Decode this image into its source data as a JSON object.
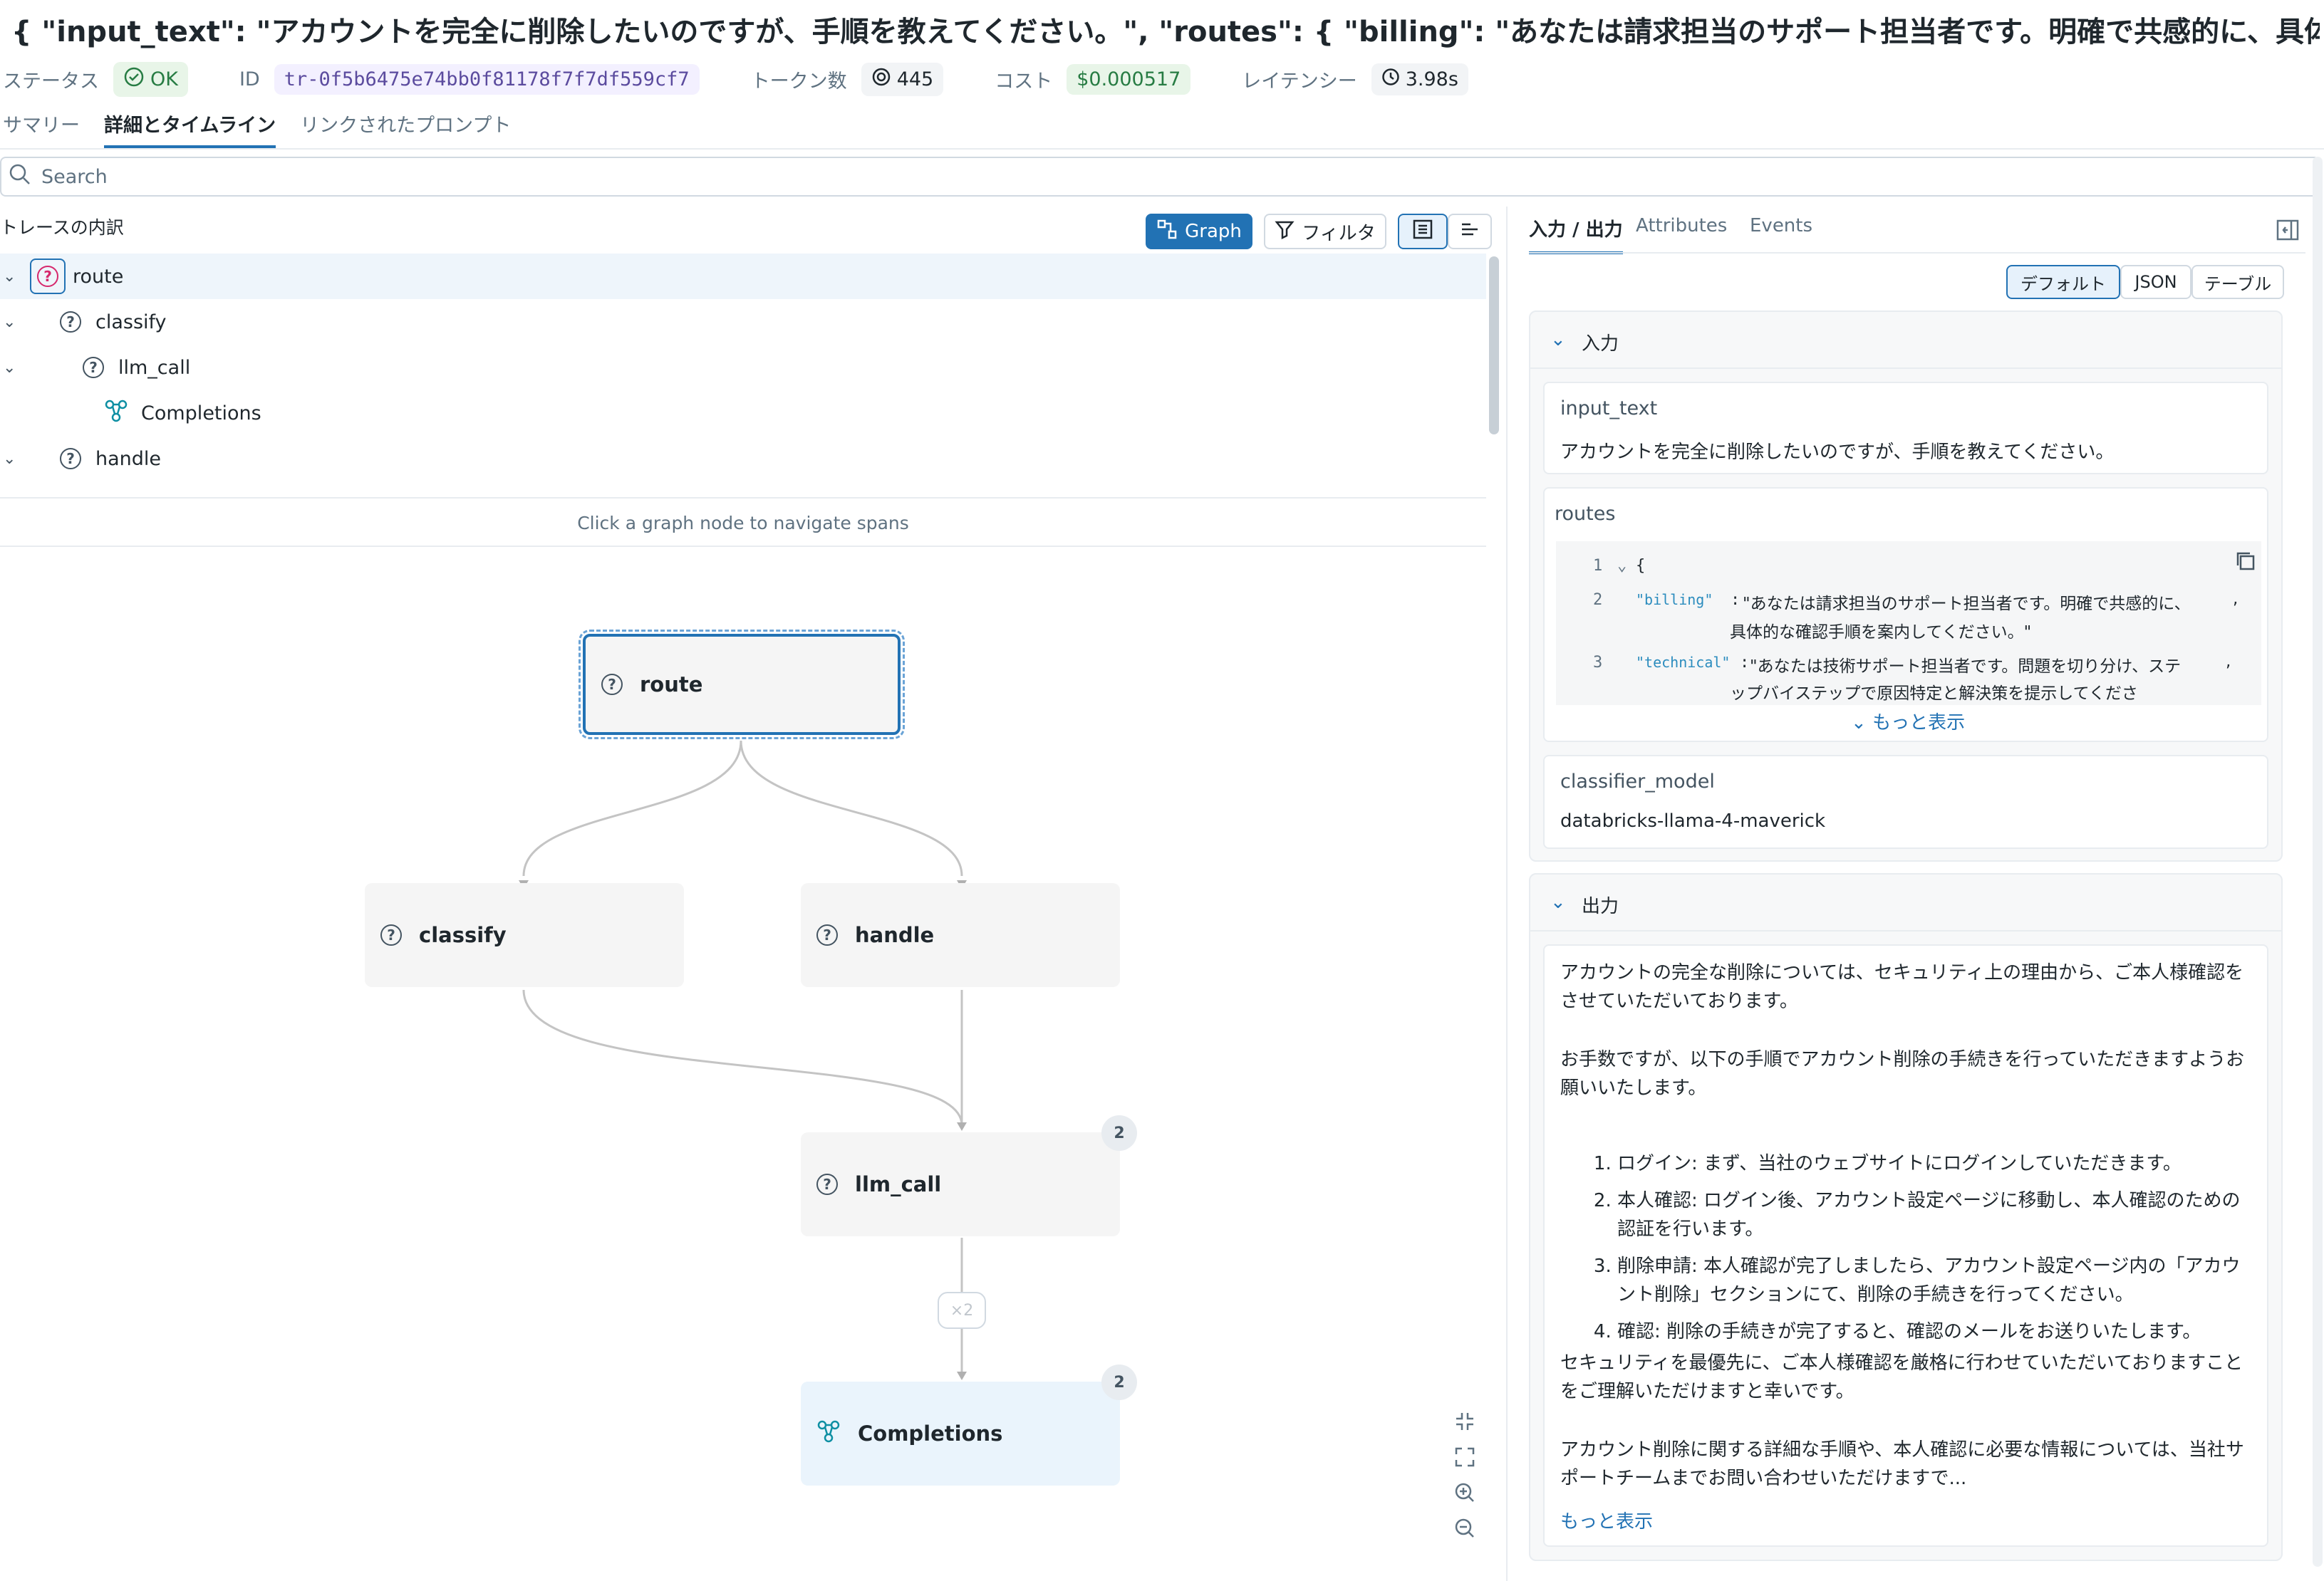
{
  "header": {
    "title": "{ \"input_text\": \"アカウントを完全に削除したいのですが、手順を教えてください。\", \"routes\": { \"billing\": \"あなたは請求担当のサポート担当者です。明確で共感的に、具体的な",
    "status_label": "ステータス",
    "status_value": "OK",
    "id_label": "ID",
    "id_value": "tr-0f5b6475e74bb0f81178f7f7df559cf7",
    "tokens_label": "トークン数",
    "tokens_value": "445",
    "cost_label": "コスト",
    "cost_value": "$0.000517",
    "latency_label": "レイテンシー",
    "latency_value": "3.98s"
  },
  "tabs": [
    "サマリー",
    "詳細とタイムライン",
    "リンクされたプロンプト"
  ],
  "search": {
    "placeholder": "Search"
  },
  "trace": {
    "title": "トレースの内訳",
    "graph_button": "Graph",
    "filter_button": "フィルタ",
    "rows": [
      {
        "label": "route"
      },
      {
        "label": "classify"
      },
      {
        "label": "llm_call"
      },
      {
        "label": "Completions"
      },
      {
        "label": "handle"
      }
    ],
    "hint": "Click a graph node to navigate spans"
  },
  "graph": {
    "nodes": {
      "route": "route",
      "classify": "classify",
      "handle": "handle",
      "llm_call": "llm_call",
      "llm_call_count": "2",
      "completions": "Completions",
      "completions_count": "2",
      "edge_label": "×2"
    }
  },
  "right": {
    "tabs": [
      "入力 / 出力",
      "Attributes",
      "Events"
    ],
    "view_modes": [
      "デフォルト",
      "JSON",
      "テーブル"
    ],
    "input_section": "入力",
    "input_text_key": "input_text",
    "input_text_value": "アカウントを完全に削除したいのですが、手順を教えてください。",
    "routes_key": "routes",
    "routes_code": {
      "l1": "{",
      "l2_key": "\"billing\"",
      "l2_val": "\"あなたは請求担当のサポート担当者です。明確で共感的に、",
      "l2_cont": "具体的な確認手順を案内してください。\"",
      "l3_key": "\"technical\"",
      "l3_val": "\"あなたは技術サポート担当者です。問題を切り分け、ステ",
      "l3_cont": "ップバイステップで原因特定と解決策を提示してくださ"
    },
    "show_more": "もっと表示",
    "classifier_key": "classifier_model",
    "classifier_value": "databricks-llama-4-maverick",
    "output_section": "出力",
    "output": {
      "p1": "アカウントの完全な削除については、セキュリティ上の理由から、ご本人様確認をさせていただいております。",
      "p2": "お手数ですが、以下の手順でアカウント削除の手続きを行っていただきますようお願いいたします。",
      "steps": [
        "ログイン: まず、当社のウェブサイトにログインしていただきます。",
        "本人確認: ログイン後、アカウント設定ページに移動し、本人確認のための認証を行います。",
        "削除申請: 本人確認が完了しましたら、アカウント設定ページ内の「アカウント削除」セクションにて、削除の手続きを行ってください。",
        "確認: 削除の手続きが完了すると、確認のメールをお送りいたします。"
      ],
      "p3": "セキュリティを最優先に、ご本人様確認を厳格に行わせていただいておりますことをご理解いただけますと幸いです。",
      "p4": "アカウント削除に関する詳細な手順や、本人確認に必要な情報については、当社サポートチームまでお問い合わせいただけますで..."
    },
    "output_show_more": "もっと表示"
  }
}
